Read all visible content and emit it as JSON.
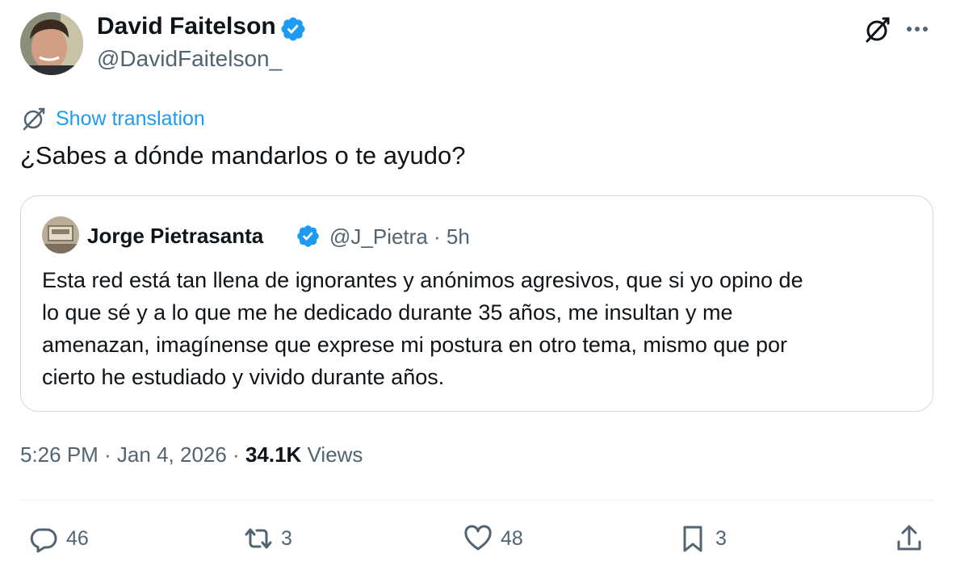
{
  "tweet": {
    "author": {
      "name": "David Faitelson",
      "handle": "@DavidFaitelson_",
      "verified": true
    },
    "translate_label": "Show translation",
    "text": "¿Sabes a dónde mandarlos o te ayudo?",
    "quoted": {
      "author_name": "Jorge Pietrasanta",
      "handle_time": "@J_Pietra · 5h",
      "verified": true,
      "lines": [
        "Esta red está tan llena de ignorantes y anónimos agresivos, que si yo opino de",
        "lo que sé y a lo que me he dedicado durante 35 años, me insultan y me",
        "amenazan, imagínense que exprese mi postura en otro tema, mismo que por",
        "cierto he estudiado y vivido durante años."
      ]
    },
    "meta": {
      "time_date": "5:26 PM · Jan 4, 2026 · ",
      "views_count": "34.1K",
      "views_label": " Views"
    },
    "actions": {
      "replies": "46",
      "reposts": "3",
      "likes": "48",
      "bookmarks": "3"
    }
  },
  "icons": {
    "verified": "verified-badge-icon",
    "grok": "grok-icon",
    "more": "more-icon",
    "translate": "translate-icon",
    "reply": "reply-icon",
    "repost": "repost-icon",
    "like": "like-icon",
    "bookmark": "bookmark-icon",
    "share": "share-icon"
  },
  "colors": {
    "accent": "#1d9bf0",
    "text_primary": "#0f1419",
    "text_secondary": "#536471",
    "border": "#cfd9de"
  }
}
